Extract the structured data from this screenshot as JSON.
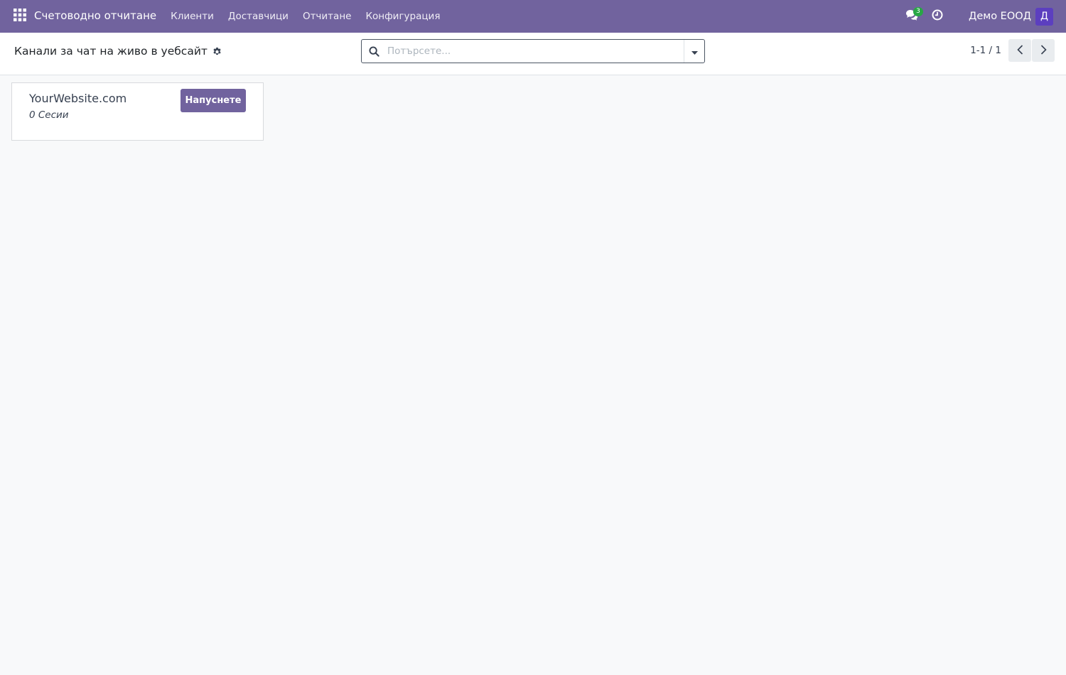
{
  "navbar": {
    "app_name": "Счетоводно отчитане",
    "menu": [
      {
        "label": "Клиенти"
      },
      {
        "label": "Доставчици"
      },
      {
        "label": "Отчитане"
      },
      {
        "label": "Конфигурация"
      }
    ],
    "messages_badge": "3",
    "company": "Демо ЕООД",
    "avatar_initial": "Д",
    "colors": {
      "brand": "#71639e",
      "avatar": "#5c3fbf",
      "badge": "#28a745"
    }
  },
  "control_panel": {
    "title": "Канали за чат на живо в уебсайт",
    "search_placeholder": "Потърсете...",
    "pager_value": "1-1 / 1"
  },
  "cards": [
    {
      "title": "YourWebsite.com",
      "sessions": "0 Сесии",
      "button_label": "Напуснете"
    }
  ]
}
